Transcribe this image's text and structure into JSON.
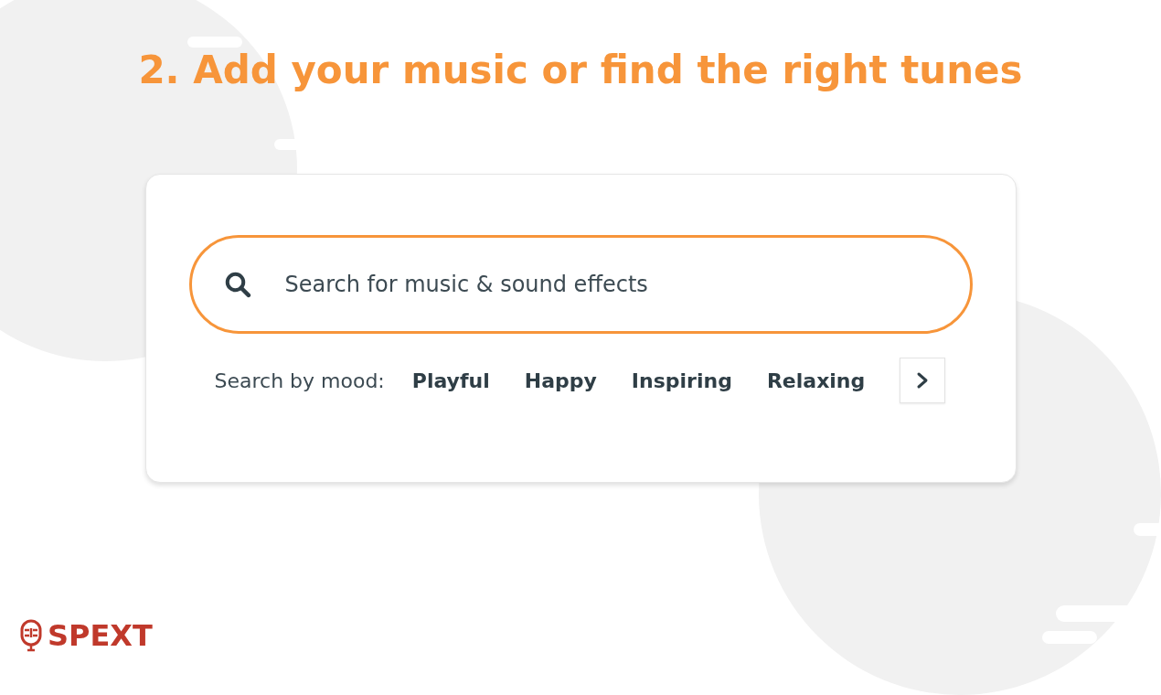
{
  "heading": "2. Add your music or find the right tunes",
  "search": {
    "placeholder": "Search for music & sound effects"
  },
  "mood": {
    "label": "Search by mood:",
    "options": [
      {
        "label": "Playful"
      },
      {
        "label": "Happy"
      },
      {
        "label": "Inspiring"
      },
      {
        "label": "Relaxing"
      }
    ]
  },
  "logo": {
    "text": "SPEXT"
  }
}
